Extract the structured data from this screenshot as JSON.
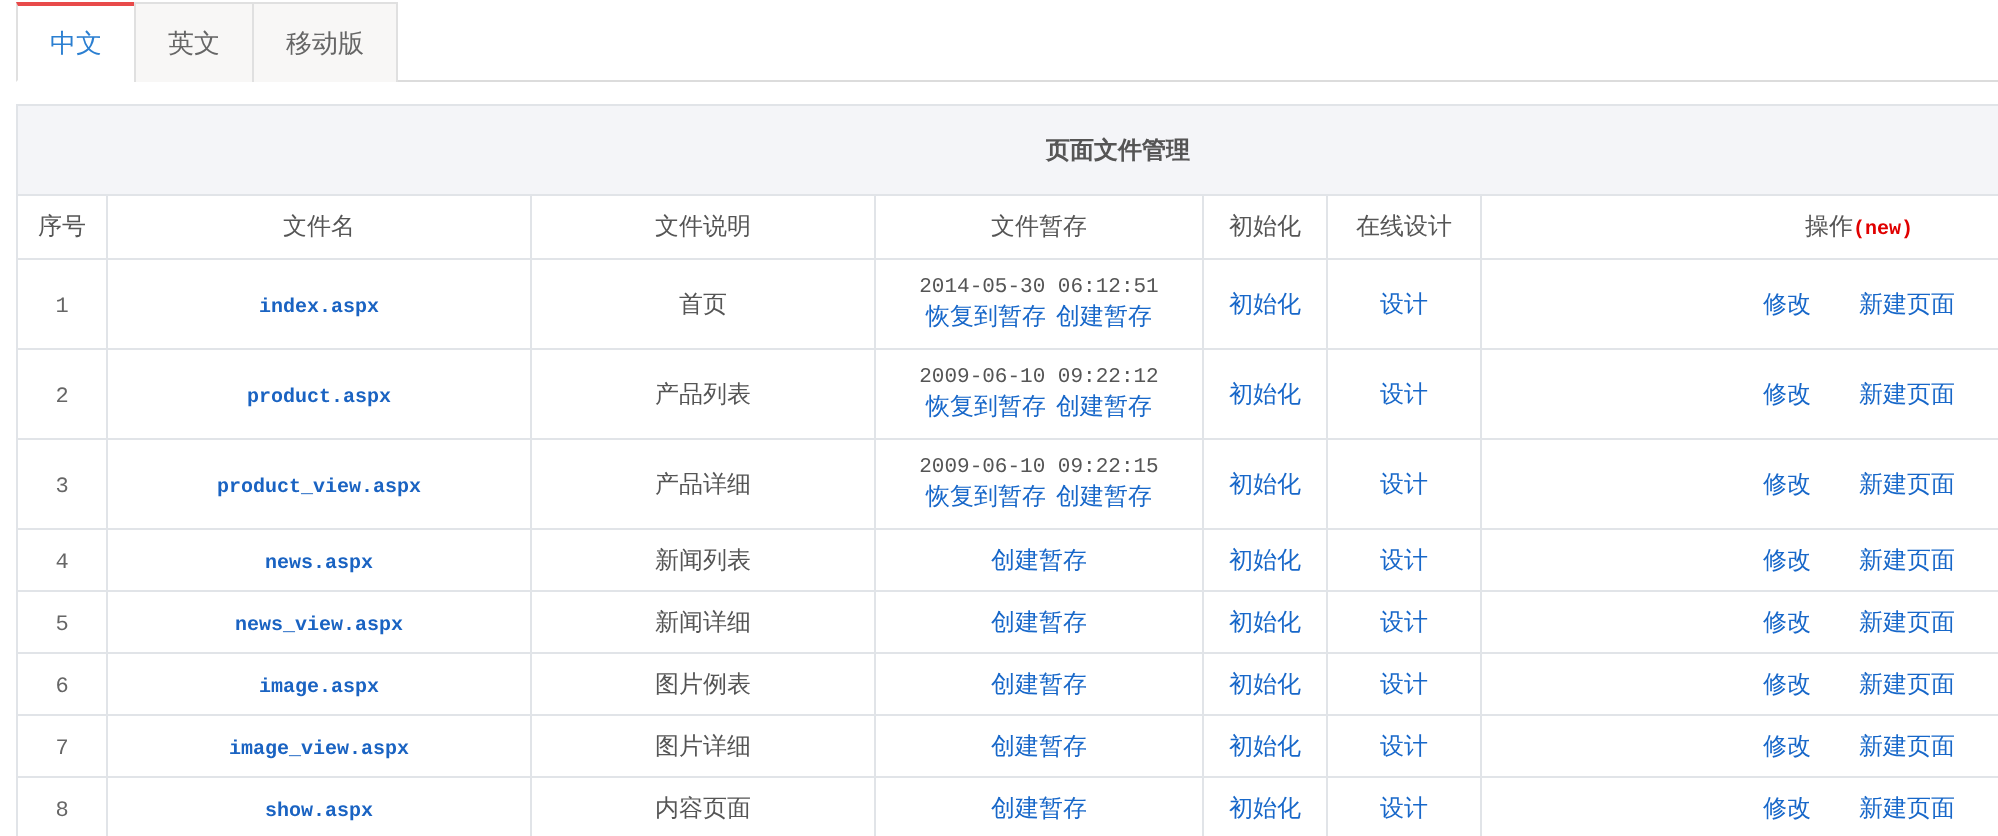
{
  "tabs": [
    {
      "label": "中文",
      "selected": true
    },
    {
      "label": "英文",
      "selected": false
    },
    {
      "label": "移动版",
      "selected": false
    }
  ],
  "table": {
    "title": "页面文件管理",
    "columns": [
      {
        "label": "序号"
      },
      {
        "label": "文件名"
      },
      {
        "label": "文件说明"
      },
      {
        "label": "文件暂存"
      },
      {
        "label": "初始化"
      },
      {
        "label": "在线设计"
      },
      {
        "label": "操作",
        "note": "(new)"
      }
    ],
    "rows": [
      {
        "no": "1",
        "file": "index.aspx",
        "desc": "首页",
        "saved_at": "2014-05-30 06:12:51",
        "backup_links": [
          "恢复到暂存",
          "创建暂存"
        ],
        "init": "初始化",
        "design": "设计",
        "actions": [
          "修改",
          "新建页面"
        ]
      },
      {
        "no": "2",
        "file": "product.aspx",
        "desc": "产品列表",
        "saved_at": "2009-06-10 09:22:12",
        "backup_links": [
          "恢复到暂存",
          "创建暂存"
        ],
        "init": "初始化",
        "design": "设计",
        "actions": [
          "修改",
          "新建页面"
        ]
      },
      {
        "no": "3",
        "file": "product_view.aspx",
        "desc": "产品详细",
        "saved_at": "2009-06-10 09:22:15",
        "backup_links": [
          "恢复到暂存",
          "创建暂存"
        ],
        "init": "初始化",
        "design": "设计",
        "actions": [
          "修改",
          "新建页面"
        ]
      },
      {
        "no": "4",
        "file": "news.aspx",
        "desc": "新闻列表",
        "backup_links": [
          "创建暂存"
        ],
        "init": "初始化",
        "design": "设计",
        "actions": [
          "修改",
          "新建页面"
        ]
      },
      {
        "no": "5",
        "file": "news_view.aspx",
        "desc": "新闻详细",
        "backup_links": [
          "创建暂存"
        ],
        "init": "初始化",
        "design": "设计",
        "actions": [
          "修改",
          "新建页面"
        ]
      },
      {
        "no": "6",
        "file": "image.aspx",
        "desc": "图片例表",
        "backup_links": [
          "创建暂存"
        ],
        "init": "初始化",
        "design": "设计",
        "actions": [
          "修改",
          "新建页面"
        ]
      },
      {
        "no": "7",
        "file": "image_view.aspx",
        "desc": "图片详细",
        "backup_links": [
          "创建暂存"
        ],
        "init": "初始化",
        "design": "设计",
        "actions": [
          "修改",
          "新建页面"
        ]
      },
      {
        "no": "8",
        "file": "show.aspx",
        "desc": "内容页面",
        "backup_links": [
          "创建暂存"
        ],
        "init": "初始化",
        "design": "设计",
        "actions": [
          "修改",
          "新建页面"
        ]
      }
    ]
  }
}
